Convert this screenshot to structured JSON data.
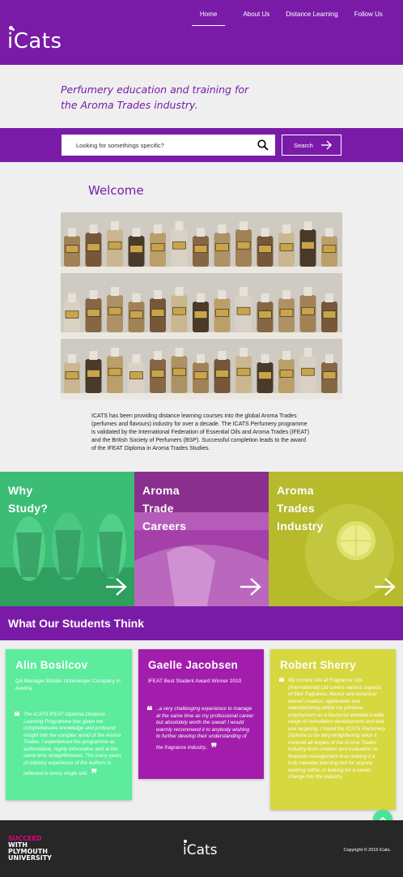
{
  "header": {
    "logo": "iCats",
    "nav": [
      "Home",
      "About Us",
      "Distance Learning",
      "Follow Us"
    ],
    "active_nav": "Home"
  },
  "tagline": "Perfumery education and training for the Aroma Trades industry.",
  "search": {
    "placeholder": "Looking for somethings specific?",
    "button_label": "Search"
  },
  "welcome": {
    "title": "Welcome",
    "intro": "ICATS has been providing distance learning courses into the global Aroma Trades (perfumes and flavours) industry for over a decade. The ICATS Perfumery programme is validated by the International Federation of Essential Oils and Aroma Trades (IFEAT) and the British Society of Perfumers (BSP). Successful completion leads to the award of the IFEAT Diploma in Aroma Trades Studies."
  },
  "tiles": [
    {
      "lines": [
        "Why",
        "Study?"
      ]
    },
    {
      "lines": [
        "Aroma",
        "Trade",
        "Careers"
      ]
    },
    {
      "lines": [
        "Aroma",
        "Trades",
        "Industry"
      ]
    }
  ],
  "students": {
    "title": "What Our Students Think",
    "cards": [
      {
        "name": "Alin Bosilcov",
        "role": "QA Manager Brüder Unterweger Company in Austria",
        "quote": "The ICATS IFEAT Diploma Distance Learning Programme has given me comprehensive knowledge and profound insight into the complex world of the Aroma Trades. I experienced the programme as authoritative, highly informative and at the same time straightforward. The many years of industry experience of the authors is reflected in every single unit."
      },
      {
        "name": "Gaelle Jacobsen",
        "role": "IFEAT Best Student Award Winner 2010",
        "quote": "..a very challenging experience to manage at the same time as my professional career but absolutely worth the sweat! I would warmly recommend it to anybody wishing to further develop their understanding of the fragrance industry.."
      },
      {
        "name": "Robert Sherry",
        "role": "",
        "quote": "My current role at Fragrance Oils (International) Ltd covers various aspects of their fragrance, flavour and botanical extract creation, application and manufacturing whilst my previous employment as a flavourist entailed a wide range of formulation development and end use targeting. I found the ICATS Perfumery Diploma to be very enlightening since it covered all angles of the Aroma Trades Industry from creation and evaluation to financial management thus making it a truly valuable learning tool for anyone working within or looking for a career change into the industry."
      }
    ]
  },
  "footer": {
    "partner_line1": "SUCCEED",
    "partner_line2": "WITH",
    "partner_line3": "PLYMOUTH",
    "partner_line4": "UNIVERSITY",
    "logo": "iCats",
    "copyright": "Copyright © 2016 iCats."
  },
  "colors": {
    "brand_purple": "#7a1ba8",
    "green": "#5cec9c",
    "magenta": "#a31dad",
    "lime": "#d7d83f",
    "footer": "#272727"
  }
}
